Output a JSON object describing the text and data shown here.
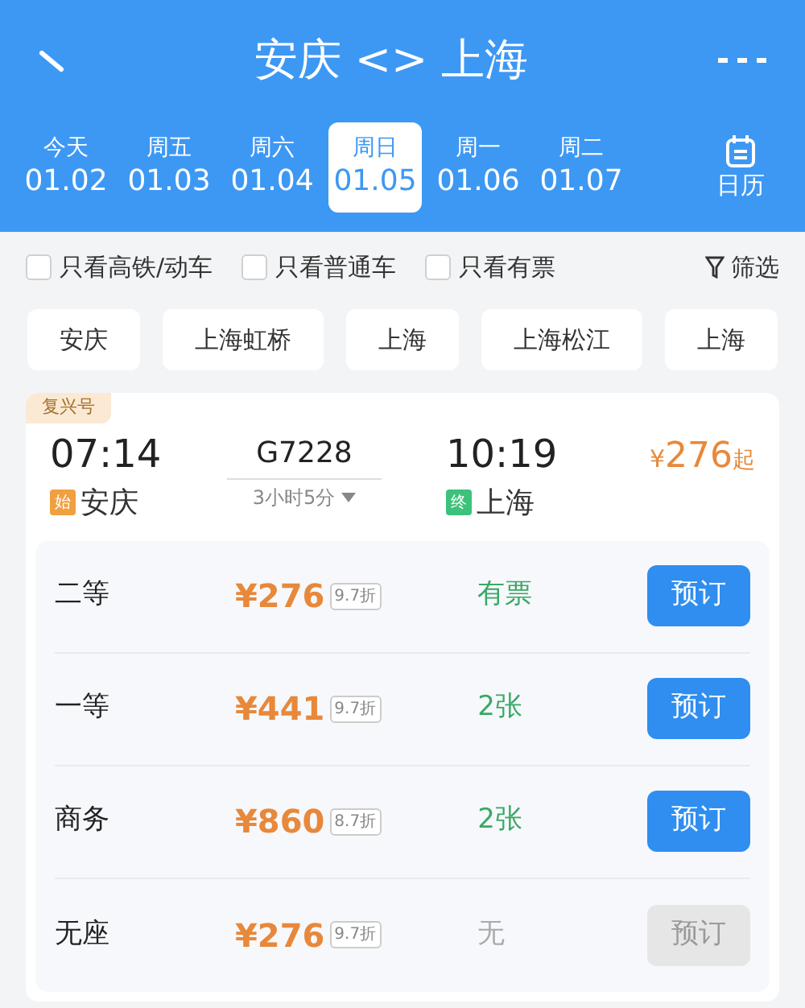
{
  "header": {
    "title": "安庆 <> 上海"
  },
  "dates": [
    {
      "weekday": "今天",
      "date": "01.02",
      "selected": false
    },
    {
      "weekday": "周五",
      "date": "01.03",
      "selected": false
    },
    {
      "weekday": "周六",
      "date": "01.04",
      "selected": false
    },
    {
      "weekday": "周日",
      "date": "01.05",
      "selected": true
    },
    {
      "weekday": "周一",
      "date": "01.06",
      "selected": false
    },
    {
      "weekday": "周二",
      "date": "01.07",
      "selected": false
    }
  ],
  "calendar": {
    "label": "日历"
  },
  "filters": [
    {
      "label": "只看高铁/动车",
      "checked": false
    },
    {
      "label": "只看普通车",
      "checked": false
    },
    {
      "label": "只看有票",
      "checked": false
    }
  ],
  "filter_button": {
    "label": "筛选"
  },
  "stations": [
    {
      "label": "安庆"
    },
    {
      "label": "上海虹桥"
    },
    {
      "label": "上海"
    },
    {
      "label": "上海松江"
    },
    {
      "label": "上海"
    }
  ],
  "train": {
    "tag": "复兴号",
    "depart_time": "07:14",
    "train_no": "G7228",
    "arrive_time": "10:19",
    "duration": "3小时5分",
    "price_currency": "¥",
    "price_amount": "276",
    "price_suffix": "起",
    "from": {
      "badge": "始",
      "station": "安庆",
      "color": "#f0a040"
    },
    "to": {
      "badge": "终",
      "station": "上海",
      "color": "#3cc27a"
    },
    "seats": [
      {
        "class": "二等",
        "price": "¥276",
        "discount": "9.7折",
        "availability": "有票",
        "disabled": false,
        "button": "预订"
      },
      {
        "class": "一等",
        "price": "¥441",
        "discount": "9.7折",
        "availability": "2张",
        "disabled": false,
        "button": "预订"
      },
      {
        "class": "商务",
        "price": "¥860",
        "discount": "8.7折",
        "availability": "2张",
        "disabled": false,
        "button": "预订"
      },
      {
        "class": "无座",
        "price": "¥276",
        "discount": "9.7折",
        "availability": "无",
        "disabled": true,
        "button": "预订"
      }
    ]
  }
}
